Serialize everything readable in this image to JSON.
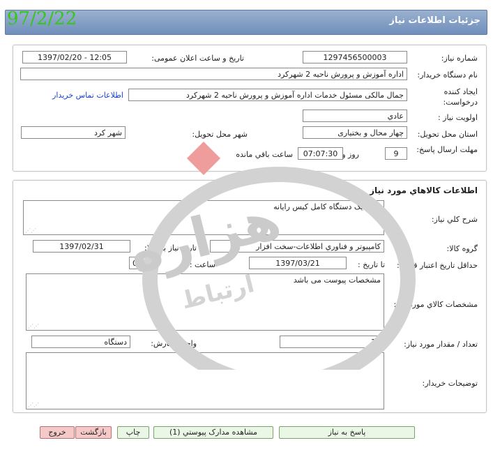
{
  "header": {
    "title": "جزئیات اطلاعات نیاز",
    "date_stamp": "97/2/22"
  },
  "info": {
    "need_number_label": "شماره نیاز:",
    "need_number": "1297456500003",
    "announce_label": "تاریخ و ساعت اعلان عمومی:",
    "announce_value": "1397/02/20 - 12:05",
    "buyer_org_label": "نام دستگاه خریدار:",
    "buyer_org": "اداره آموزش و پرورش ناحیه 2 شهرکرد",
    "creator_label": "ایجاد کننده درخواست:",
    "creator": "جمال مالکی مسئول خدمات اداره آموزش و پرورش ناحیه 2 شهرکرد",
    "contact_link": "اطلاعات تماس خریدار",
    "priority_label": "اولویت نیاز :",
    "priority": "عادي",
    "province_label": "استان محل تحویل:",
    "province": "چهار محال و بختیاری",
    "city_label": "شهر محل تحویل:",
    "city": "شهر کرد",
    "deadline_label": "مهلت ارسال پاسخ:",
    "days": "9",
    "days_label": "روز و",
    "time_left": "07:07:30",
    "time_left_label": "ساعت باقي مانده"
  },
  "goods": {
    "section_title": "اطلاعات کالاهاي مورد نياز",
    "desc_label": "شرح کلي نياز:",
    "desc": "خرید یک دستگاه کامل کیس رایانه",
    "group_label": "گروه کالا:",
    "group": "کامپيوتر و فناوري اطلاعات-سخت افزار",
    "need_date_label": "تاريخ نياز به کالا:",
    "need_date": "1397/02/31",
    "price_valid_label": "حداقل تاریخ اعتبار قیمت:",
    "until_date_label": "تا تاريخ :",
    "until_date": "1397/03/21",
    "time_label": "ساعت :",
    "time": "02:12",
    "spec_label": "مشخصات کالاي مورد نياز:",
    "spec": "مشخصات پیوست می باشد",
    "qty_label": "تعداد / مقدار مورد نياز:",
    "qty": "17",
    "unit_label": "واحد شمارش:",
    "unit": "دستگاه",
    "buyer_notes_label": "توضيحات خريدار:",
    "buyer_notes": ""
  },
  "buttons": {
    "reply": "پاسخ به نياز",
    "attachments": "مشاهده مدارک پيوستي (1)",
    "print": "چاپ",
    "back": "بازگشت",
    "exit": "خروج"
  },
  "watermark": {
    "text_big": "هزاره",
    "text_small": "ارتباط"
  }
}
